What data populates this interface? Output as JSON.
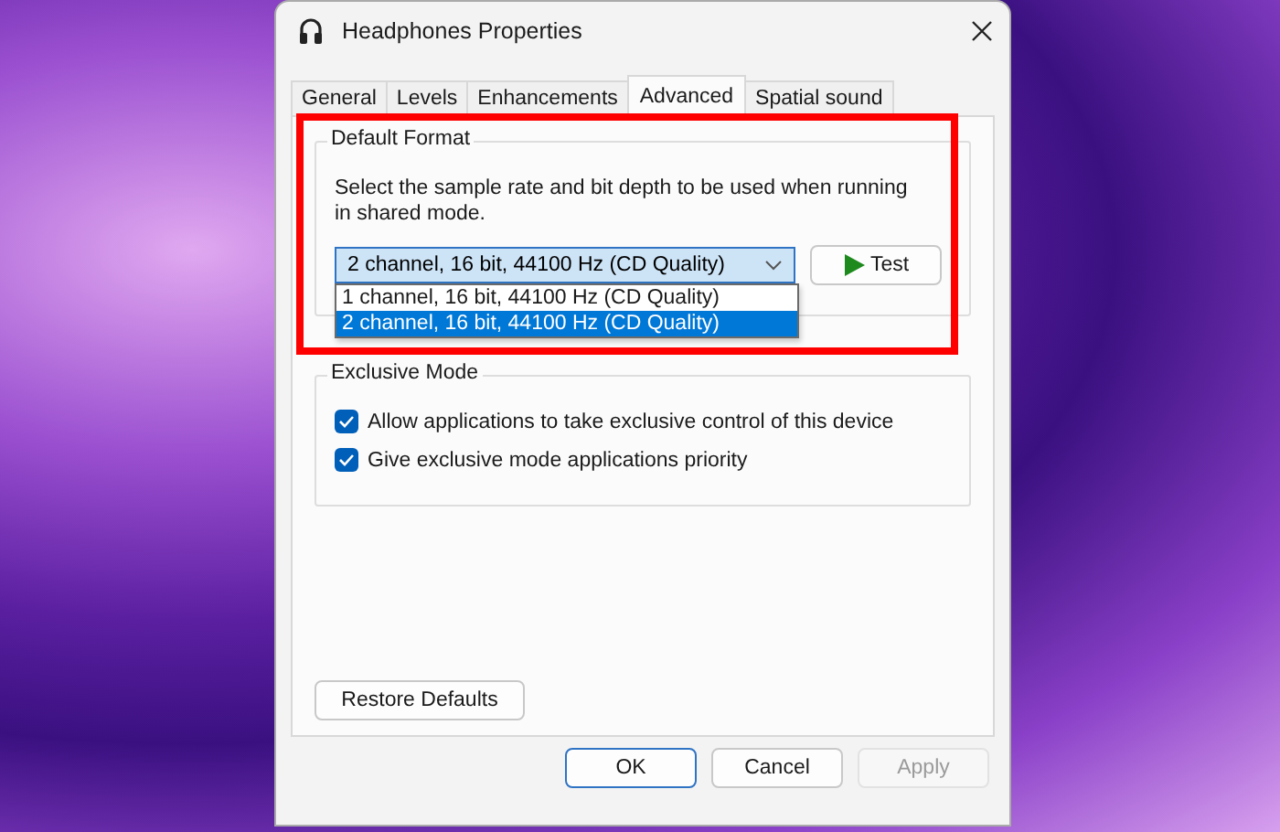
{
  "window": {
    "title": "Headphones Properties"
  },
  "tabs": [
    {
      "label": "General",
      "selected": false
    },
    {
      "label": "Levels",
      "selected": false
    },
    {
      "label": "Enhancements",
      "selected": false
    },
    {
      "label": "Advanced",
      "selected": true
    },
    {
      "label": "Spatial sound",
      "selected": false
    }
  ],
  "default_format": {
    "title": "Default Format",
    "description": "Select the sample rate and bit depth to be used when running in shared mode.",
    "dropdown": {
      "value": "2 channel, 16 bit, 44100 Hz (CD Quality)",
      "expanded": true,
      "options": [
        {
          "label": "1 channel, 16 bit, 44100 Hz (CD Quality)",
          "selected": false
        },
        {
          "label": "2 channel, 16 bit, 44100 Hz (CD Quality)",
          "selected": true
        }
      ]
    },
    "test_button": "Test",
    "highlighted": true
  },
  "exclusive_mode": {
    "title": "Exclusive Mode",
    "options": [
      {
        "label": "Allow applications to take exclusive control of this device",
        "checked": true
      },
      {
        "label": "Give exclusive mode applications priority",
        "checked": true
      }
    ]
  },
  "restore_button": "Restore Defaults",
  "buttons": [
    {
      "label": "OK",
      "kind": "default",
      "disabled": false
    },
    {
      "label": "Cancel",
      "kind": "normal",
      "disabled": false
    },
    {
      "label": "Apply",
      "kind": "normal",
      "disabled": true
    }
  ]
}
